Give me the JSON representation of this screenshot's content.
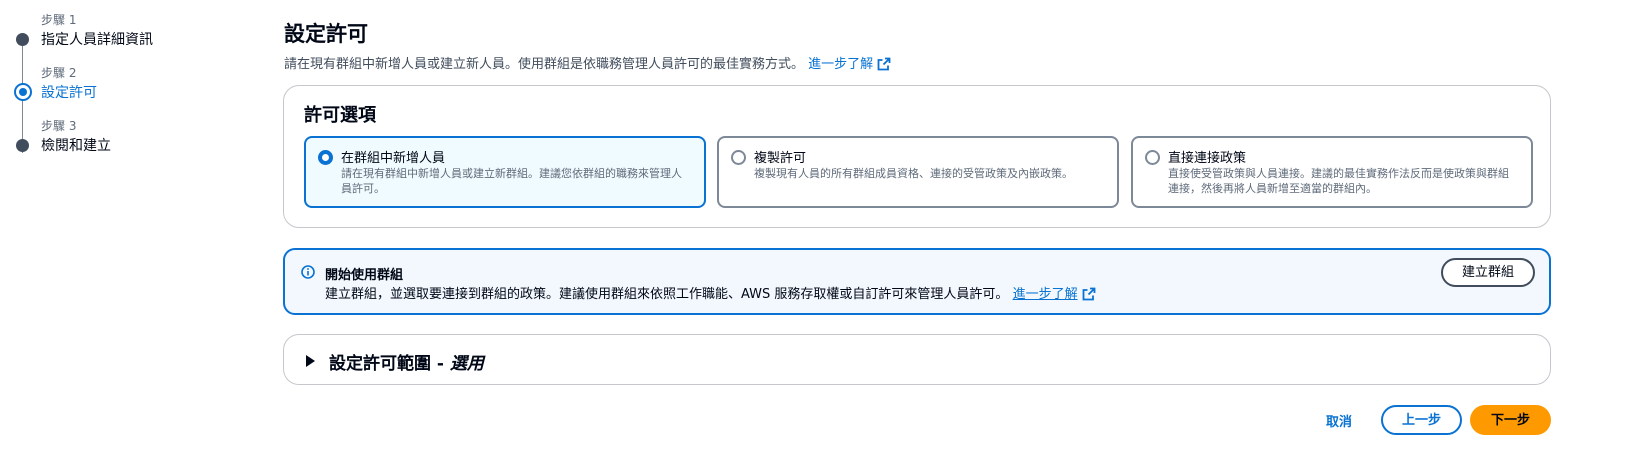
{
  "steps": [
    {
      "num": "步驟 1",
      "title": "指定人員詳細資訊"
    },
    {
      "num": "步驟 2",
      "title": "設定許可"
    },
    {
      "num": "步驟 3",
      "title": "檢閱和建立"
    }
  ],
  "page": {
    "title": "設定許可",
    "description": "請在現有群組中新增人員或建立新人員。使用群組是依職務管理人員許可的最佳實務方式。",
    "learn_more": "進一步了解"
  },
  "permission_options": {
    "heading": "許可選項",
    "tiles": [
      {
        "name": "在群組中新增人員",
        "desc": "請在現有群組中新增人員或建立新群組。建議您依群組的職務來管理人員許可。",
        "selected": true
      },
      {
        "name": "複製許可",
        "desc": "複製現有人員的所有群組成員資格、連接的受管政策及內嵌政策。",
        "selected": false
      },
      {
        "name": "直接連接政策",
        "desc": "直接使受管政策與人員連接。建議的最佳實務作法反而是使政策與群組連接，然後再將人員新增至適當的群組內。",
        "selected": false
      }
    ]
  },
  "info": {
    "title": "開始使用群組",
    "text": "建立群組，並選取要連接到群組的政策。建議使用群組來依照工作職能、AWS 服務存取權或自訂許可來管理人員許可。",
    "learn_more": "進一步了解",
    "button": "建立群組"
  },
  "boundary": {
    "title": "設定許可範圍 - ",
    "optional": "選用"
  },
  "footer": {
    "cancel": "取消",
    "previous": "上一步",
    "next": "下一步"
  },
  "colors": {
    "accent": "#0972d3",
    "primary_button": "#ff9900",
    "text": "#000716"
  }
}
